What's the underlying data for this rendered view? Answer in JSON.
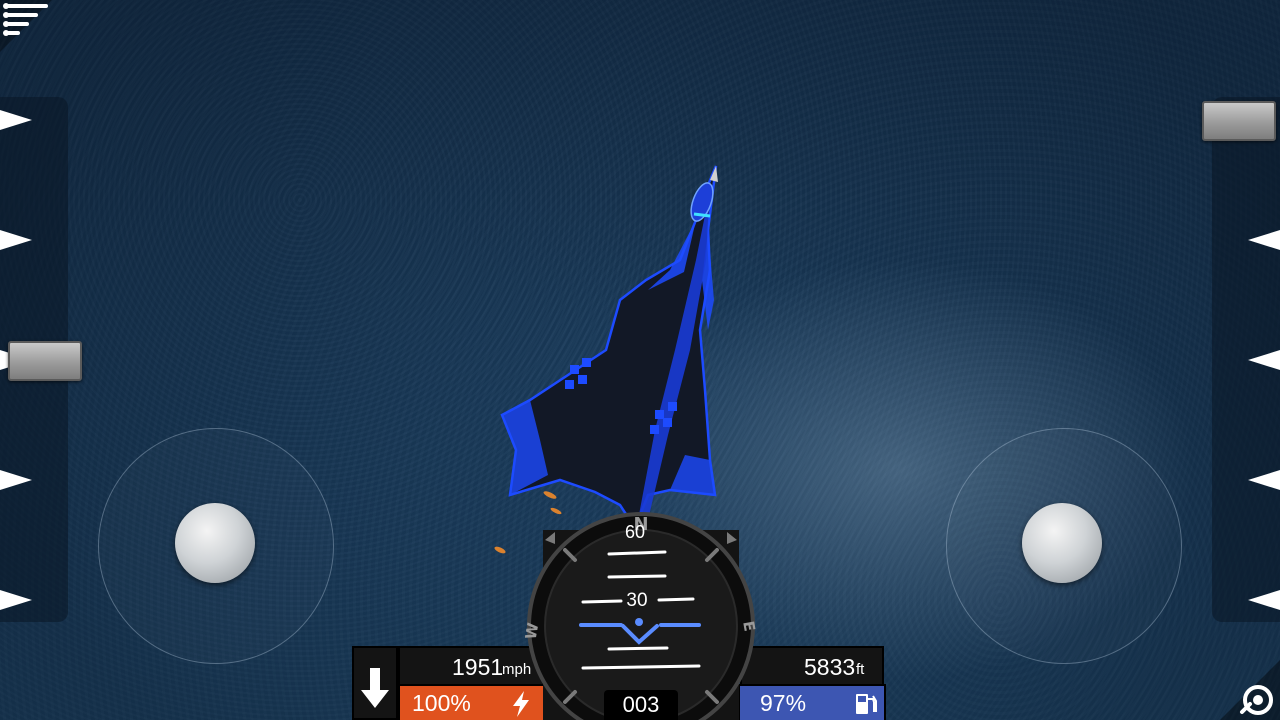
{
  "hud": {
    "speed_value": "1951",
    "speed_unit": "mph",
    "altitude_value": "5833",
    "altitude_unit": "ft",
    "throttle_percent": "100%",
    "fuel_percent": "97%",
    "heading": "003",
    "pitch_labels": [
      "60",
      "30"
    ],
    "compass": {
      "north": "N",
      "east": "E",
      "west": "W"
    }
  },
  "controls": {
    "left_slider_level": 0.5,
    "right_slider_level": 1.0
  },
  "icons": {
    "menu": "menu-icon",
    "gear": "arrow-down-icon",
    "throttle": "lightning-icon",
    "fuel": "fuel-pump-icon",
    "camera": "camera-rotate-icon"
  },
  "colors": {
    "throttle_bar": "#e0521e",
    "fuel_bar": "#3d56b2",
    "attitude_marker": "#5a8cff",
    "aircraft_accent": "#1d4bff"
  }
}
